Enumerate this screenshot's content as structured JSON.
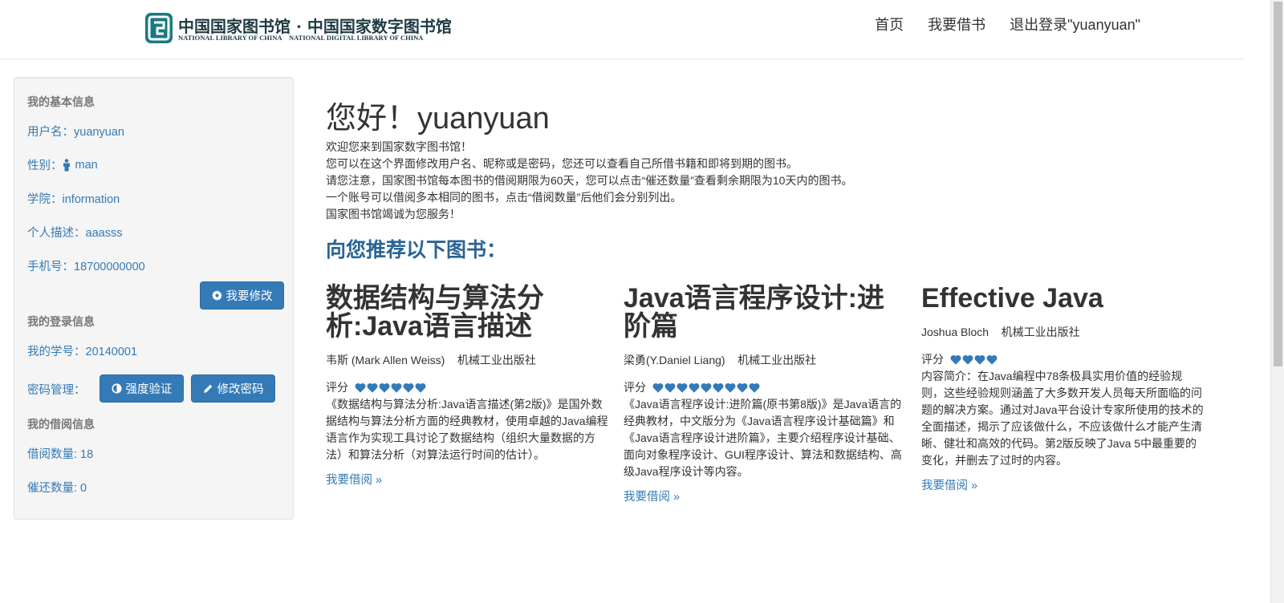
{
  "header": {
    "logo_cn": "中国国家图书馆 · 中国国家数字图书馆",
    "logo_en_left": "NATIONAL LIBRARY OF CHINA",
    "logo_en_right": "NATIONAL DIGITAL LIBRARY OF CHINA",
    "nav": [
      "首页",
      "我要借书",
      "退出登录\"yuanyuan\""
    ]
  },
  "sidebar": {
    "basic_heading": "我的基本信息",
    "username": "用户名：yuanyuan",
    "gender_label": "性别：",
    "gender_value": "man",
    "college": "学院：information",
    "description": "个人描述：aaasss",
    "phone": "手机号：18700000000",
    "edit_button": "我要修改",
    "login_heading": "我的登录信息",
    "student_id": "我的学号：20140001",
    "password_label": "密码管理：",
    "strength_button": "强度验证",
    "change_password_button": "修改密码",
    "borrow_heading": "我的借阅信息",
    "borrow_count": "借阅数量: 18",
    "return_count": "催还数量: 0"
  },
  "main": {
    "greeting": "您好！yuanyuan",
    "intro": [
      "欢迎您来到国家数字图书馆！",
      "您可以在这个界面修改用户名、昵称或是密码，您还可以查看自己所借书籍和即将到期的图书。",
      "请您注意，国家图书馆每本图书的借阅期限为60天，您可以点击“催还数量”查看剩余期限为10天内的图书。",
      "一个账号可以借阅多本相同的图书，点击“借阅数量”后他们会分别列出。",
      "国家图书馆竭诚为您服务！"
    ],
    "recommend_title": "向您推荐以下图书：",
    "rating_label": "评分",
    "borrow_link": "我要借阅 »",
    "books": [
      {
        "title": "数据结构与算法分析:Java语言描述",
        "author": "韦斯 (Mark Allen Weiss)",
        "publisher": "机械工业出版社",
        "rating": 6,
        "description": "《数据结构与算法分析:Java语言描述(第2版)》是国外数据结构与算法分析方面的经典教材，使用卓越的Java编程语言作为实现工具讨论了数据结构（组织大量数据的方法）和算法分析（对算法运行时间的估计）。"
      },
      {
        "title": "Java语言程序设计:进阶篇",
        "author": "梁勇(Y.Daniel Liang)",
        "publisher": "机械工业出版社",
        "rating": 9,
        "description": "《Java语言程序设计:进阶篇(原书第8版)》是Java语言的经典教材，中文版分为《Java语言程序设计基础篇》和《Java语言程序设计进阶篇》，主要介绍程序设计基础、面向对象程序设计、GUI程序设计、算法和数据结构、高级Java程序设计等内容。"
      },
      {
        "title": "Effective Java",
        "author": "Joshua Bloch",
        "publisher": "机械工业出版社",
        "rating": 4,
        "description": "内容简介：在Java编程中78条极具实用价值的经验规则，这些经验规则涵盖了大多数开发人员每天所面临的问题的解决方案。通过对Java平台设计专家所使用的技术的全面描述，揭示了应该做什么，不应该做什么才能产生清晰、健壮和高效的代码。第2版反映了Java 5中最重要的变化，并删去了过时的内容。"
      }
    ]
  },
  "colors": {
    "link": "#337ab7",
    "button": "#337ab7",
    "heading_blue": "#2a6496",
    "sidebar_bg": "#f5f5f5"
  }
}
